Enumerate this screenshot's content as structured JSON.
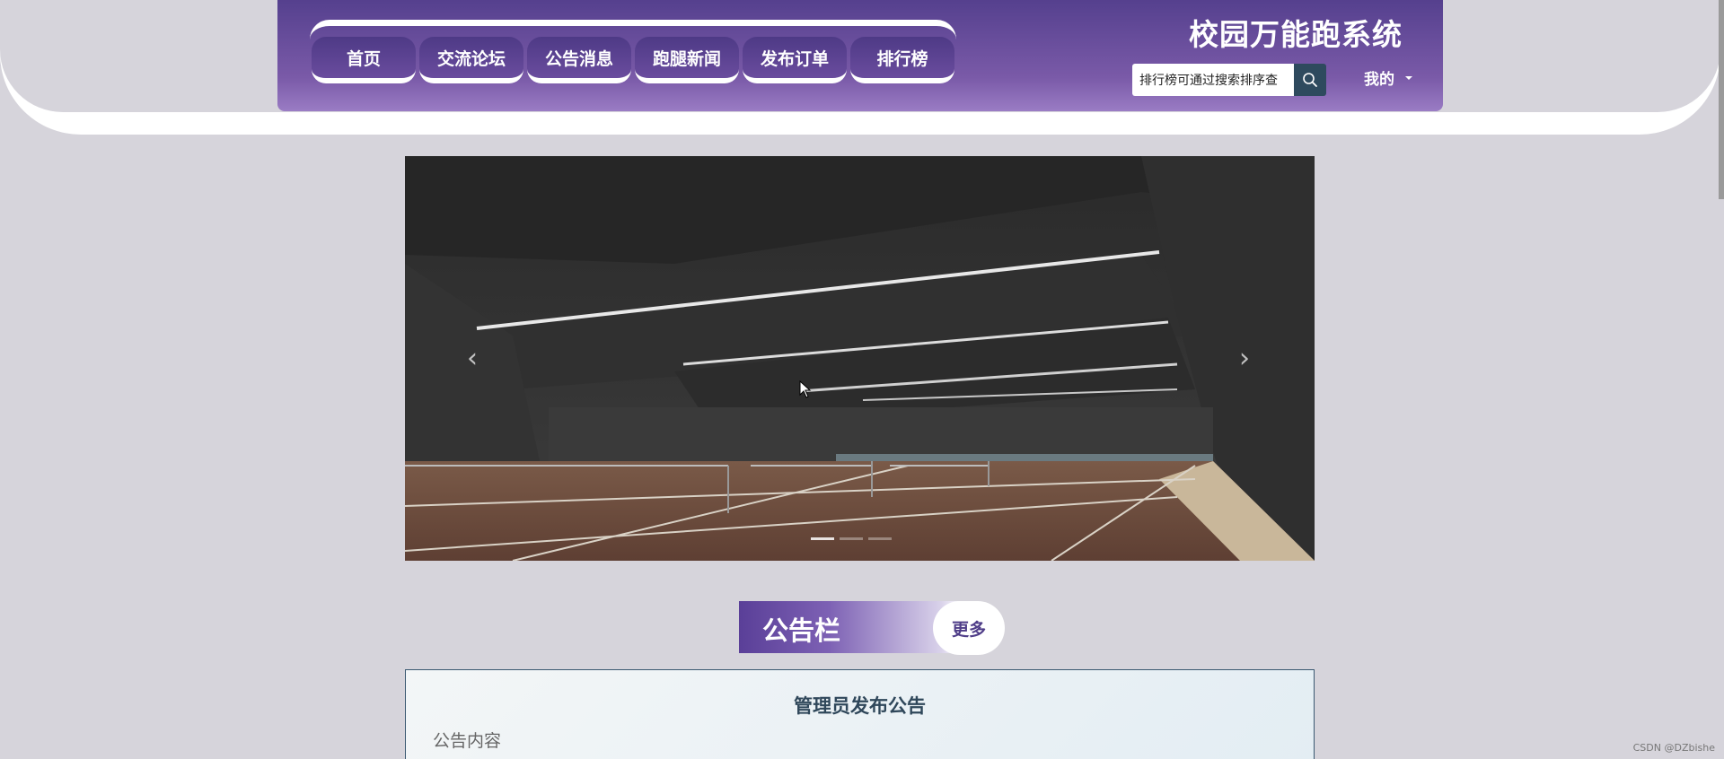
{
  "header": {
    "site_title": "校园万能跑系统",
    "nav": [
      {
        "label": "首页"
      },
      {
        "label": "交流论坛"
      },
      {
        "label": "公告消息"
      },
      {
        "label": "跑腿新闻"
      },
      {
        "label": "发布订单"
      },
      {
        "label": "排行榜"
      }
    ],
    "search": {
      "value": "排行榜可通过搜索排序查",
      "icon": "search-icon"
    },
    "mine_label": "我的"
  },
  "carousel": {
    "slide_count": 3,
    "active_slide": 1,
    "prev_icon": "chevron-left-icon",
    "next_icon": "chevron-right-icon"
  },
  "notice": {
    "section_title": "公告栏",
    "more_label": "更多",
    "card_title": "管理员发布公告",
    "card_content": "公告内容"
  },
  "watermark": "CSDN @DZbishe",
  "colors": {
    "header_purple": "#55408e",
    "accent_purple": "#4f3d88",
    "page_bg": "#d6d4db"
  }
}
